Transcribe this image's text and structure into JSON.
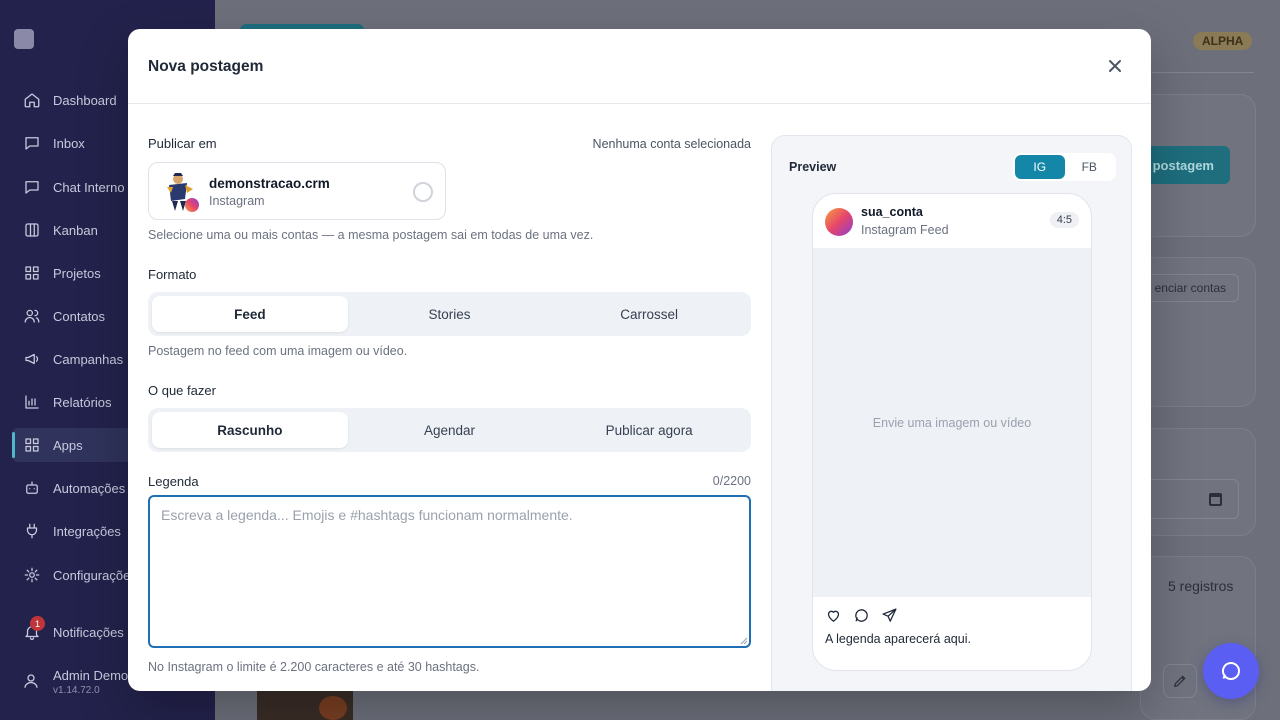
{
  "sidebar": {
    "items": [
      {
        "label": "Dashboard",
        "icon": "home-icon"
      },
      {
        "label": "Inbox",
        "icon": "inbox-icon"
      },
      {
        "label": "Chat Interno",
        "icon": "chat-icon"
      },
      {
        "label": "Kanban",
        "icon": "kanban-icon"
      },
      {
        "label": "Projetos",
        "icon": "grid-icon"
      },
      {
        "label": "Contatos",
        "icon": "users-icon"
      },
      {
        "label": "Campanhas",
        "icon": "megaphone-icon"
      },
      {
        "label": "Relatórios",
        "icon": "bar-chart-icon"
      },
      {
        "label": "Apps",
        "icon": "apps-icon"
      },
      {
        "label": "Automações",
        "icon": "bot-icon"
      },
      {
        "label": "Integrações",
        "icon": "plug-icon"
      },
      {
        "label": "Configurações",
        "icon": "gear-icon"
      }
    ],
    "notifications": {
      "label": "Notificações",
      "badge": "1"
    },
    "user": {
      "name": "Admin Demo",
      "version": "v1.14.72.0"
    }
  },
  "background": {
    "alpha_badge": "ALPHA",
    "post_button": "postagem",
    "manage_accounts": "enciar contas",
    "records": "5 registros"
  },
  "modal": {
    "title": "Nova postagem",
    "publish_in_label": "Publicar em",
    "no_account_selected": "Nenhuma conta selecionada",
    "account": {
      "name": "demonstracao.crm",
      "platform": "Instagram",
      "selected": false
    },
    "accounts_hint": "Selecione uma ou mais contas — a mesma postagem sai em todas de uma vez.",
    "format_label": "Formato",
    "format_options": [
      "Feed",
      "Stories",
      "Carrossel"
    ],
    "format_selected": "Feed",
    "format_hint": "Postagem no feed com uma imagem ou vídeo.",
    "action_label": "O que fazer",
    "action_options": [
      "Rascunho",
      "Agendar",
      "Publicar agora"
    ],
    "action_selected": "Rascunho",
    "caption_label": "Legenda",
    "caption_count": "0/2200",
    "caption_value": "",
    "caption_placeholder": "Escreva a legenda... Emojis e #hashtags funcionam normalmente.",
    "caption_hint": "No Instagram o limite é 2.200 caracteres e até 30 hashtags."
  },
  "preview": {
    "title": "Preview",
    "tabs": [
      "IG",
      "FB"
    ],
    "tab_selected": "IG",
    "username": "sua_conta",
    "feed_label": "Instagram Feed",
    "ratio": "4:5",
    "media_placeholder": "Envie uma imagem ou vídeo",
    "caption_placeholder": "A legenda aparecerá aqui."
  },
  "colors": {
    "accent": "#1487a8",
    "focus_border": "#1f6fb5",
    "sidebar_bg": "#23224c",
    "chat_fab": "#5b5ef2"
  }
}
